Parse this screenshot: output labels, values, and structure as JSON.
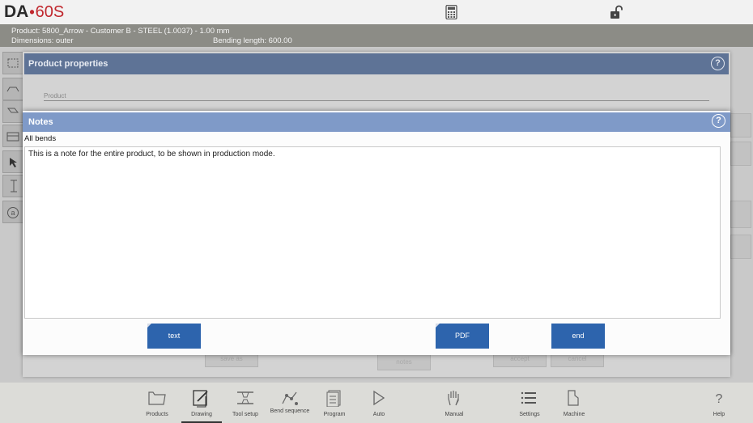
{
  "app": {
    "logo_brand": "DA",
    "logo_dot": "•",
    "logo_model": "60S",
    "calculator_icon": "calculator-icon",
    "lock_icon": "unlock-icon"
  },
  "info": {
    "product_line": "Product: 5800_Arrow - Customer B - STEEL (1.0037) - 1.00 mm",
    "dimensions": "Dimensions: outer",
    "bending_length": "Bending length: 600.00"
  },
  "background_dialog": {
    "title": "Product properties",
    "help": "?",
    "field_label": "Product",
    "buttons": [
      "save as",
      "notes",
      "accept",
      "cancel"
    ]
  },
  "notes_dialog": {
    "title": "Notes",
    "help": "?",
    "scope_label": "All bends",
    "note_text": "This is a note for the entire product, to be shown in production mode.",
    "buttons": {
      "text": "text",
      "pdf": "PDF",
      "end": "end"
    }
  },
  "bottom_nav": [
    {
      "label": "Products",
      "icon": "folder-icon"
    },
    {
      "label": "Drawing",
      "icon": "drawing-icon",
      "active": true
    },
    {
      "label": "Tool setup",
      "icon": "tool-setup-icon"
    },
    {
      "label": "Bend sequence",
      "icon": "bend-sequence-icon"
    },
    {
      "label": "Program",
      "icon": "program-icon"
    },
    {
      "label": "Auto",
      "icon": "play-icon"
    },
    {
      "label": "Manual",
      "icon": "hand-icon"
    },
    {
      "label": "Settings",
      "icon": "settings-list-icon"
    },
    {
      "label": "Machine",
      "icon": "machine-icon"
    },
    {
      "label": "Help",
      "icon": "help-icon"
    }
  ],
  "colors": {
    "accent_button": "#2d64ad",
    "notes_header": "#7f9ac8",
    "bg_header": "#5e7396",
    "logo_red": "#c0272d"
  }
}
